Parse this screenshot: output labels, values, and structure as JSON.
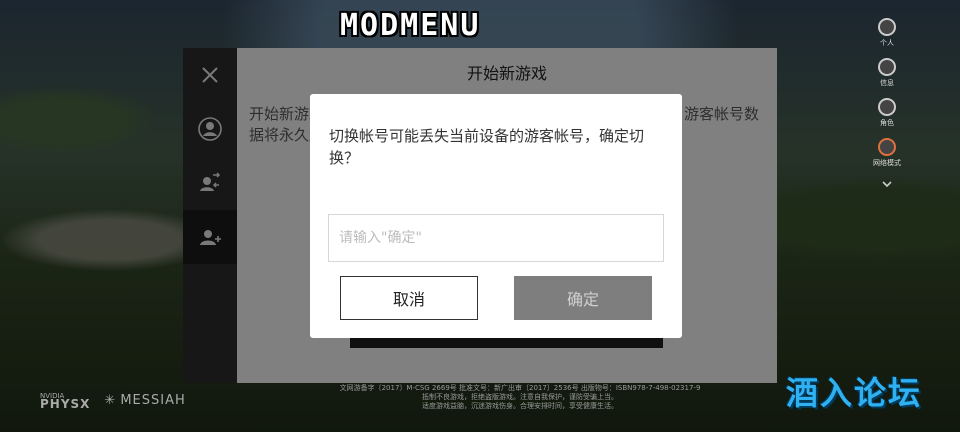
{
  "overlay_title": "MODMENU",
  "right_bar": [
    {
      "icon": "account-icon",
      "label": "个人"
    },
    {
      "icon": "info-icon",
      "label": "信息"
    },
    {
      "icon": "person-icon",
      "label": "角色"
    },
    {
      "icon": "gamepad-icon",
      "label": "网络模式"
    }
  ],
  "panel": {
    "title": "开始新游戏",
    "body_text": "开始新游戏将清除当前设备上的游客帐号数据并且替换原有帐号，游客帐号数据将永久遗失。请慎重执行操作。"
  },
  "dialog": {
    "message": "切换帐号可能丢失当前设备的游客帐号，确定切换？",
    "input_placeholder": "请输入\"确定\"",
    "input_value": "",
    "cancel_label": "取消",
    "confirm_label": "确定"
  },
  "footer_lines": [
    "文网游备字〔2017〕M-CSG 2669号  批准文号：新广出审〔2017〕2536号 出版物号：ISBN978-7-498-02317-9",
    "抵制不良游戏，拒绝盗版游戏。注意自我保护，谨防受骗上当。",
    "适度游戏益脑，沉迷游戏伤身。合理安排时间，享受健康生活。"
  ],
  "logos": {
    "nvidia": "NVIDIA",
    "physx": "PHYSX",
    "messiah": "MESSIAH"
  },
  "watermark": "酒入论坛",
  "colors": {
    "panel_bg": "#e9e9e9",
    "sidebar_bg": "#2a2a2a",
    "confirm_disabled": "#7e7e7e",
    "watermark": "#2fb0f0"
  }
}
